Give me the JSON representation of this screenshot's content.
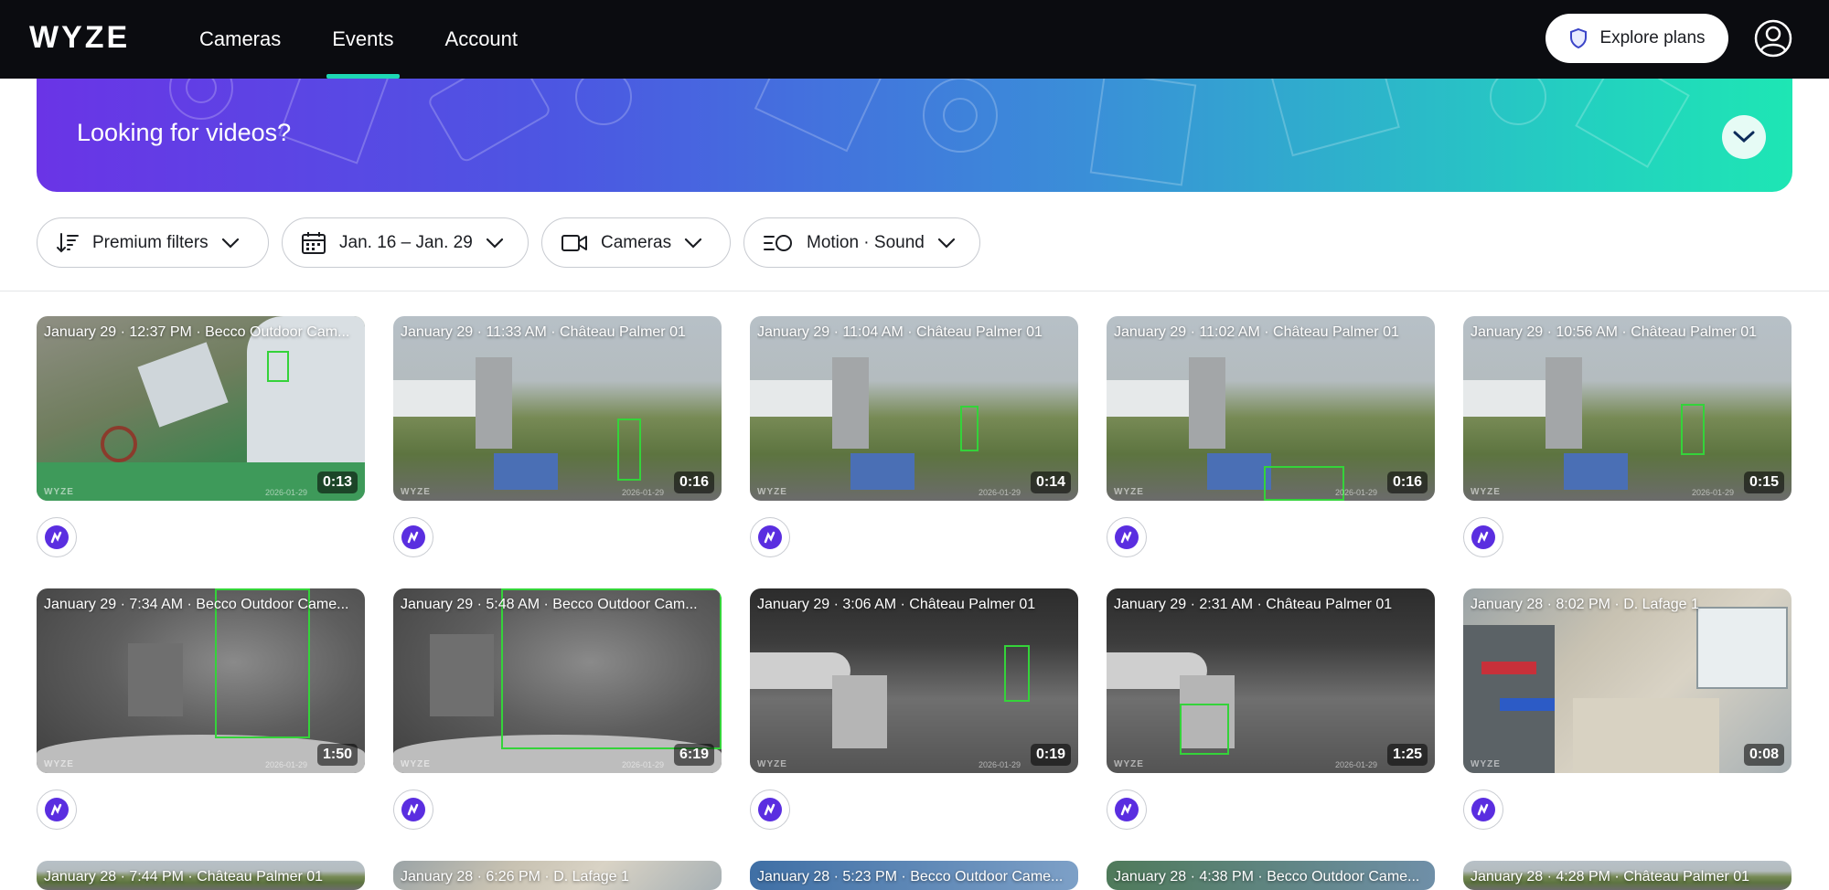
{
  "nav": {
    "logo": "WYZE",
    "items": [
      "Cameras",
      "Events",
      "Account"
    ],
    "active": "Events",
    "explore_label": "Explore plans"
  },
  "banner": {
    "title": "Looking for videos?"
  },
  "filters": {
    "premium": "Premium filters",
    "date": "Jan. 16 – Jan. 29",
    "cameras": "Cameras",
    "types": "Motion · Sound"
  },
  "watermark": "WYZE",
  "events": [
    {
      "label": "January 29 · 12:37 PM · Becco Outdoor Cam...",
      "duration": "0:13",
      "wmdate": "2026-01-29"
    },
    {
      "label": "January 29 · 11:33 AM · Château Palmer 01",
      "duration": "0:16",
      "wmdate": "2026-01-29"
    },
    {
      "label": "January 29 · 11:04 AM · Château Palmer 01",
      "duration": "0:14",
      "wmdate": "2026-01-29"
    },
    {
      "label": "January 29 · 11:02 AM · Château Palmer 01",
      "duration": "0:16",
      "wmdate": "2026-01-29"
    },
    {
      "label": "January 29 · 10:56 AM · Château Palmer 01",
      "duration": "0:15",
      "wmdate": "2026-01-29"
    },
    {
      "label": "January 29 · 7:34 AM · Becco Outdoor Came...",
      "duration": "1:50",
      "wmdate": "2026-01-29"
    },
    {
      "label": "January 29 · 5:48 AM · Becco Outdoor Cam...",
      "duration": "6:19",
      "wmdate": "2026-01-29"
    },
    {
      "label": "January 29 · 3:06 AM · Château Palmer 01",
      "duration": "0:19",
      "wmdate": "2026-01-29"
    },
    {
      "label": "January 29 · 2:31 AM · Château Palmer 01",
      "duration": "1:25",
      "wmdate": "2026-01-29"
    },
    {
      "label": "January 28 · 8:02 PM · D. Lafage 1",
      "duration": "0:08",
      "wmdate": ""
    },
    {
      "label": "January 28 · 7:44 PM · Château Palmer 01",
      "duration": "",
      "wmdate": ""
    },
    {
      "label": "January 28 · 6:26 PM · D. Lafage 1",
      "duration": "",
      "wmdate": ""
    },
    {
      "label": "January 28 · 5:23 PM · Becco Outdoor Came...",
      "duration": "",
      "wmdate": ""
    },
    {
      "label": "January 28 · 4:38 PM · Becco Outdoor Came...",
      "duration": "",
      "wmdate": ""
    },
    {
      "label": "January 28 · 4:28 PM · Château Palmer 01",
      "duration": "",
      "wmdate": ""
    }
  ],
  "colors": {
    "accent": "#1ed8b4",
    "badge": "#5a2ee0",
    "topbar": "#0b0c10"
  }
}
